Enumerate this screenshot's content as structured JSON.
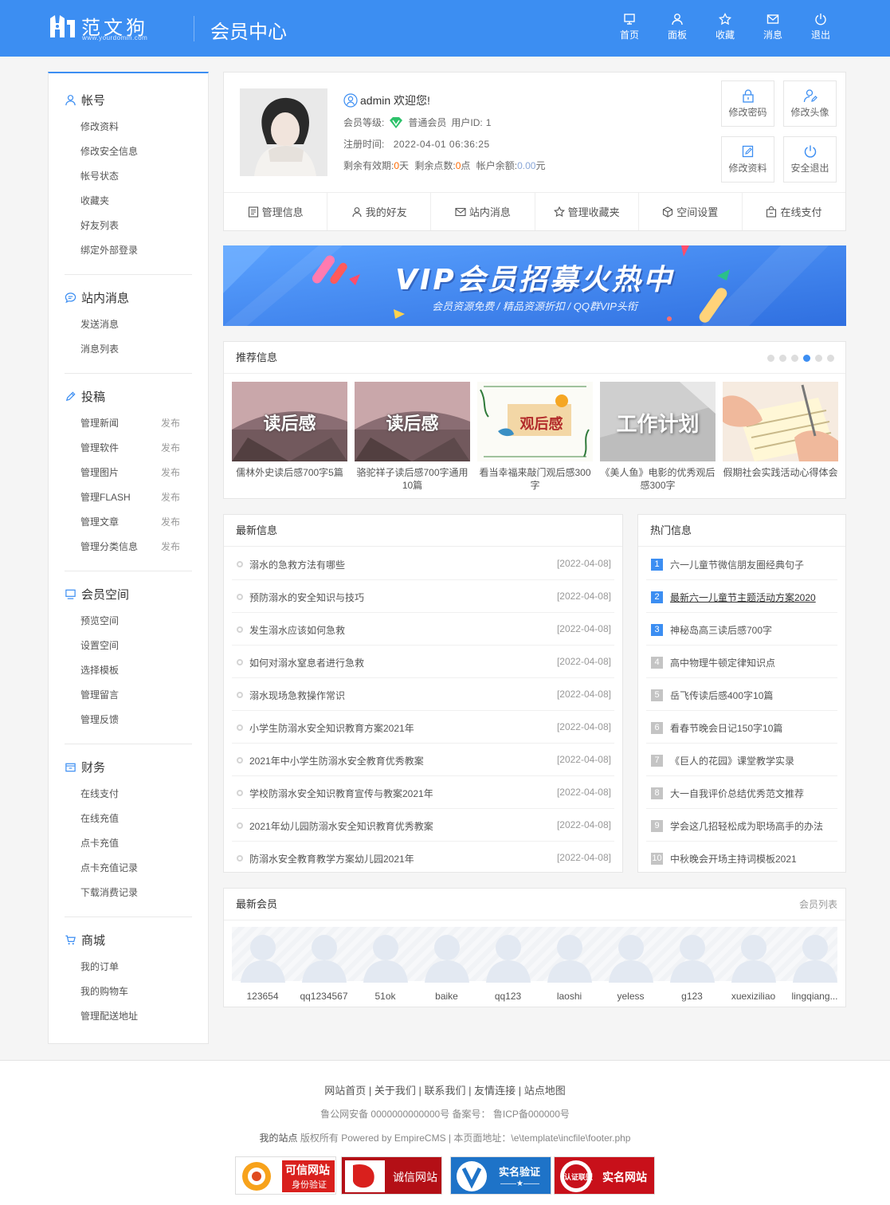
{
  "header": {
    "logo_text": "范文狗",
    "logo_url": "www.yourdomin.com",
    "title": "会员中心",
    "nav": [
      {
        "label": "首页",
        "icon": "monitor-icon"
      },
      {
        "label": "面板",
        "icon": "user-icon"
      },
      {
        "label": "收藏",
        "icon": "star-icon"
      },
      {
        "label": "消息",
        "icon": "mail-icon"
      },
      {
        "label": "退出",
        "icon": "power-icon"
      }
    ],
    "accent": "#3c8ef2"
  },
  "sidebar": {
    "groups": [
      {
        "title": "帐号",
        "icon": "user-icon",
        "items": [
          "修改资料",
          "修改安全信息",
          "帐号状态",
          "收藏夹",
          "好友列表",
          "绑定外部登录"
        ]
      },
      {
        "title": "站内消息",
        "icon": "chat-icon",
        "items": [
          "发送消息",
          "消息列表"
        ]
      },
      {
        "title": "投稿",
        "icon": "pen-icon",
        "items": [
          "管理新闻",
          "管理软件",
          "管理图片",
          "管理FLASH",
          "管理文章",
          "管理分类信息"
        ],
        "action": "发布"
      },
      {
        "title": "会员空间",
        "icon": "monitor-icon",
        "items": [
          "预览空间",
          "设置空间",
          "选择模板",
          "管理留言",
          "管理反馈"
        ]
      },
      {
        "title": "财务",
        "icon": "wallet-icon",
        "items": [
          "在线支付",
          "在线充值",
          "点卡充值",
          "点卡充值记录",
          "下载消费记录"
        ]
      },
      {
        "title": "商城",
        "icon": "cart-icon",
        "items": [
          "我的订单",
          "我的购物车",
          "管理配送地址"
        ]
      }
    ]
  },
  "profile": {
    "greeting": "admin 欢迎您!",
    "level_label": "会员等级:",
    "level_value": "普通会员",
    "uid_label": "用户ID:",
    "uid_value": "1",
    "reg_label": "注册时间:",
    "reg_value": "2022-04-01 06:36:25",
    "days_label": "剩余有效期:",
    "days_value": "0",
    "days_unit": "天",
    "points_label": "剩余点数:",
    "points_value": "0",
    "points_unit": "点",
    "balance_label": "帐户余额:",
    "balance_value": "0.00",
    "balance_unit": "元",
    "buttons": [
      "修改密码",
      "修改头像",
      "修改资料",
      "安全退出"
    ],
    "tabs": [
      "管理信息",
      "我的好友",
      "站内消息",
      "管理收藏夹",
      "空间设置",
      "在线支付"
    ]
  },
  "banner": {
    "title": "VIP会员招募火热中",
    "subtitle": "会员资源免费 / 精品资源折扣 / QQ群VIP头衔"
  },
  "recommend": {
    "title": "推荐信息",
    "dots_total": 6,
    "dots_active": 4,
    "items": [
      {
        "caption": "儒林外史读后感700字5篇",
        "thumb_text": "读后感"
      },
      {
        "caption": "骆驼祥子读后感700字通用10篇",
        "thumb_text": "读后感"
      },
      {
        "caption": "看当幸福来敲门观后感300字",
        "thumb_text": "观后感"
      },
      {
        "caption": "《美人鱼》电影的优秀观后感300字",
        "thumb_text": "工作计划"
      },
      {
        "caption": "假期社会实践活动心得体会",
        "thumb_text": ""
      }
    ]
  },
  "latest": {
    "title": "最新信息",
    "rows": [
      {
        "title": "溺水的急救方法有哪些",
        "date": "[2022-04-08]"
      },
      {
        "title": "预防溺水的安全知识与技巧",
        "date": "[2022-04-08]"
      },
      {
        "title": "发生溺水应该如何急救",
        "date": "[2022-04-08]"
      },
      {
        "title": "如何对溺水窒息者进行急救",
        "date": "[2022-04-08]"
      },
      {
        "title": "溺水现场急救操作常识",
        "date": "[2022-04-08]"
      },
      {
        "title": "小学生防溺水安全知识教育方案2021年",
        "date": "[2022-04-08]"
      },
      {
        "title": "2021年中小学生防溺水安全教育优秀教案",
        "date": "[2022-04-08]"
      },
      {
        "title": "学校防溺水安全知识教育宣传与教案2021年",
        "date": "[2022-04-08]"
      },
      {
        "title": "2021年幼儿园防溺水安全知识教育优秀教案",
        "date": "[2022-04-08]"
      },
      {
        "title": "防溺水安全教育教学方案幼儿园2021年",
        "date": "[2022-04-08]"
      }
    ]
  },
  "hot": {
    "title": "热门信息",
    "rows": [
      {
        "num": "1",
        "title": "六一儿童节微信朋友圈经典句子"
      },
      {
        "num": "2",
        "title": "最新六一儿童节主题活动方案2020"
      },
      {
        "num": "3",
        "title": "神秘岛高三读后感700字"
      },
      {
        "num": "4",
        "title": "高中物理牛顿定律知识点"
      },
      {
        "num": "5",
        "title": "岳飞传读后感400字10篇"
      },
      {
        "num": "6",
        "title": "看春节晚会日记150字10篇"
      },
      {
        "num": "7",
        "title": "《巨人的花园》课堂教学实录"
      },
      {
        "num": "8",
        "title": "大一自我评价总结优秀范文推荐"
      },
      {
        "num": "9",
        "title": "学会这几招轻松成为职场高手的办法"
      },
      {
        "num": "10",
        "title": "中秋晚会开场主持词模板2021"
      }
    ]
  },
  "members": {
    "title": "最新会员",
    "more": "会员列表",
    "list": [
      "123654",
      "qq1234567",
      "51ok",
      "baike",
      "qq123",
      "laoshi",
      "yeless",
      "g123",
      "xuexiziliao",
      "lingqiang..."
    ]
  },
  "footer": {
    "links": "网站首页 | 关于我们 | 联系我们 | 友情连接 | 站点地图",
    "icp": "鲁公网安备 0000000000000号 备案号： 鲁ICP备000000号",
    "site_name": "我的站点",
    "powered": "版权所有 Powered by EmpireCMS | 本页面地址：\\e\\template\\incfile\\footer.php",
    "badges": [
      {
        "main": "可信网站",
        "sub": "身份验证"
      },
      {
        "main": "诚信网站",
        "sub": ""
      },
      {
        "main": "实名验证",
        "sub": "——★——"
      },
      {
        "main": "实名网站",
        "sub": "认证联盟"
      }
    ]
  }
}
